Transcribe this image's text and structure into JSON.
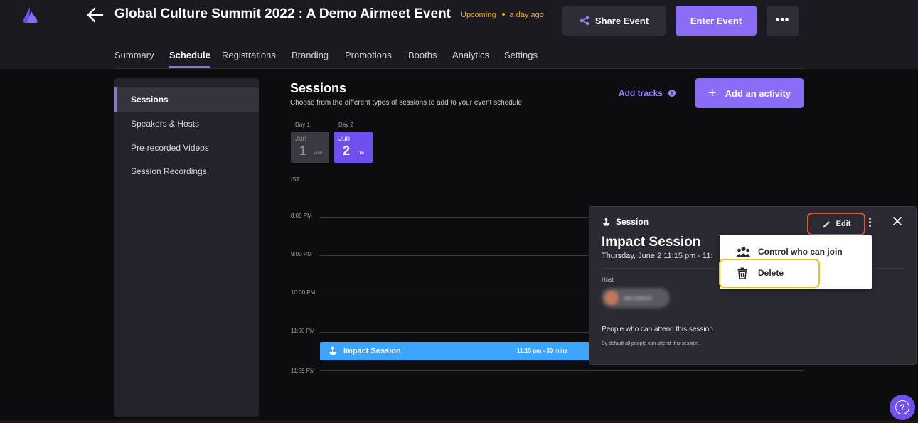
{
  "app": {
    "title": "Global Culture Summit 2022 : A Demo Airmeet Event",
    "status": "Upcoming",
    "status_time": "a day ago",
    "accent_color": "#8b6cf7",
    "status_color": "#f5a623"
  },
  "header": {
    "share_label": "Share Event",
    "enter_label": "Enter Event",
    "more_label": "•••"
  },
  "tabs": [
    "Summary",
    "Schedule",
    "Registrations",
    "Branding",
    "Promotions",
    "Booths",
    "Analytics",
    "Settings"
  ],
  "active_tab": "Schedule",
  "sidebar": {
    "items": [
      "Sessions",
      "Speakers & Hosts",
      "Pre-recorded Videos",
      "Session Recordings"
    ],
    "active": "Sessions"
  },
  "main": {
    "title": "Sessions",
    "subtitle": "Choose from the different types of sessions to add to your event schedule",
    "add_tracks": "Add tracks",
    "add_activity": "Add an activity"
  },
  "days": [
    {
      "label": "Day 1",
      "month": "Jun",
      "num": "1",
      "dow": "Wed",
      "selected": false
    },
    {
      "label": "Day 2",
      "month": "Jun",
      "num": "2",
      "dow": "Thu",
      "selected": true
    }
  ],
  "timeline": {
    "timezone": "IST",
    "times": [
      "8:00 PM",
      "9:00 PM",
      "10:00 PM",
      "11:00 PM",
      "11:59 PM"
    ]
  },
  "event": {
    "name": "Impact Session",
    "time": "11:15 pm - 30 mins",
    "color": "#3ea5ff"
  },
  "panel": {
    "type": "Session",
    "edit_label": "Edit",
    "title": "Impact Session",
    "date": "Thursday, June 2   11:15 pm - 11:",
    "host_label": "Host",
    "host_name": "Jaki Adams",
    "attend_title": "People who can attend this session",
    "attend_sub": "By default all people can attend this session."
  },
  "menu": {
    "items": [
      {
        "label": "Control who can join",
        "icon": "people-icon"
      },
      {
        "label": "Delete",
        "icon": "trash-icon"
      }
    ]
  },
  "help": {
    "label": "?"
  }
}
